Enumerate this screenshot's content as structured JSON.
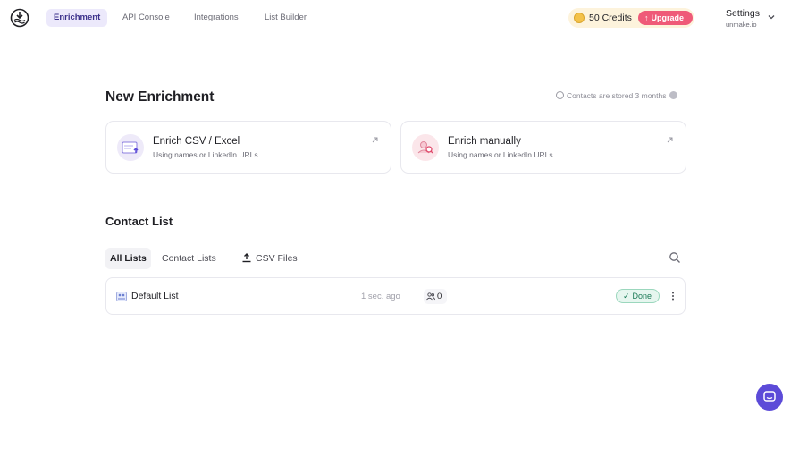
{
  "nav": {
    "tabs": [
      {
        "label": "Enrichment",
        "active": true
      },
      {
        "label": "API Console",
        "active": false
      },
      {
        "label": "Integrations",
        "active": false
      },
      {
        "label": "List Builder",
        "active": false
      }
    ],
    "credits": "50 Credits",
    "upgrade_label": "Upgrade",
    "settings_label": "Settings",
    "settings_domain": "unmake.io"
  },
  "enrichment": {
    "title": "New Enrichment",
    "storage_note": "Contacts are stored 3 months",
    "cards": [
      {
        "title": "Enrich CSV / Excel",
        "subtitle": "Using names or LinkedIn URLs",
        "icon": "csv-upload-icon"
      },
      {
        "title": "Enrich manually",
        "subtitle": "Using names or LinkedIn URLs",
        "icon": "person-search-icon"
      }
    ]
  },
  "contacts": {
    "title": "Contact List",
    "tabs": [
      {
        "label": "All Lists",
        "active": true
      },
      {
        "label": "Contact Lists",
        "active": false
      },
      {
        "label": "CSV Files",
        "active": false
      }
    ],
    "rows": [
      {
        "name": "Default List",
        "time": "1 sec. ago",
        "count": "0",
        "status": "Done"
      }
    ]
  },
  "colors": {
    "accent": "#5c4bd8",
    "upgrade": "#ef5a78",
    "done": "#1b7a56"
  }
}
